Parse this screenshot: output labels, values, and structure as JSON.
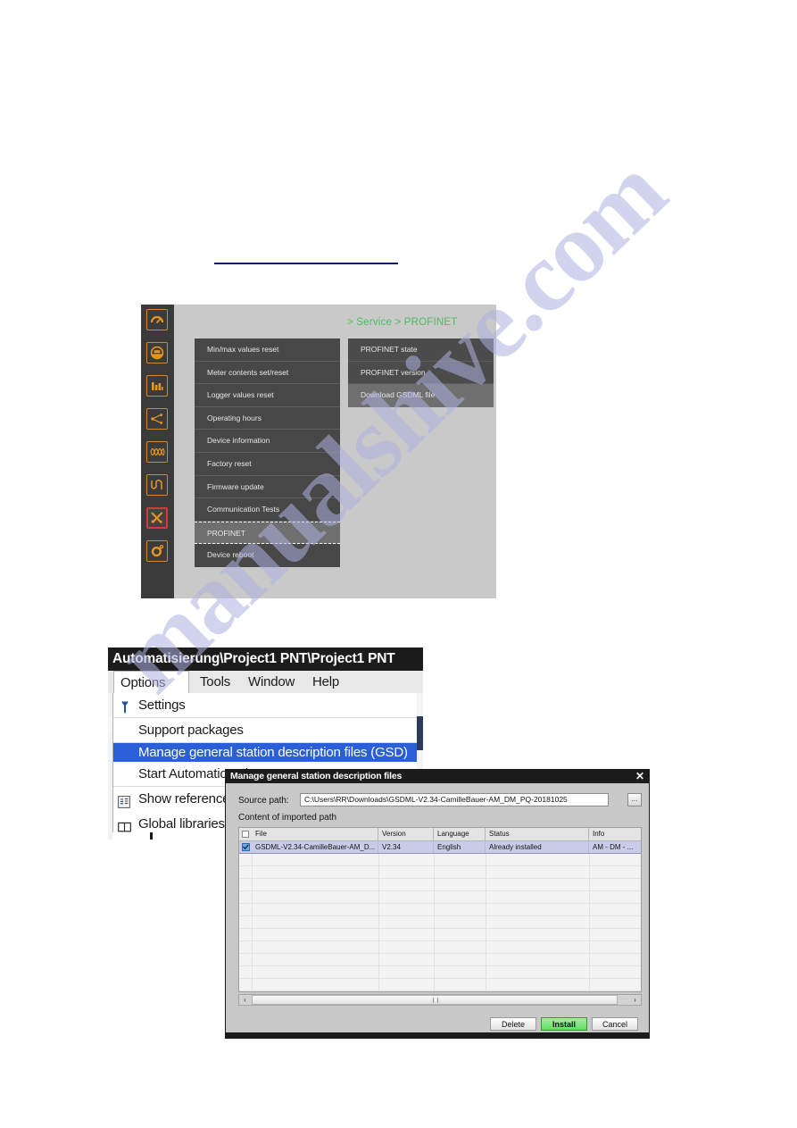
{
  "watermark": {
    "text": "manualshive.com"
  },
  "device_ui": {
    "breadcrumb": "> Service > PROFINET",
    "rail_icons": [
      {
        "name": "gauge-icon"
      },
      {
        "name": "energy-meter-icon"
      },
      {
        "name": "bar-chart-icon"
      },
      {
        "name": "network-topology-icon"
      },
      {
        "name": "harmonics-icon"
      },
      {
        "name": "waveform-icon"
      },
      {
        "name": "service-tools-icon"
      },
      {
        "name": "settings-gear-icon"
      }
    ],
    "menu_left": [
      {
        "label": "Min/max values reset",
        "selected": false
      },
      {
        "label": "Meter contents set/reset",
        "selected": false
      },
      {
        "label": "Logger values reset",
        "selected": false
      },
      {
        "label": "Operating hours",
        "selected": false
      },
      {
        "label": "Device information",
        "selected": false
      },
      {
        "label": "Factory reset",
        "selected": false
      },
      {
        "label": "Firmware update",
        "selected": false
      },
      {
        "label": "Communication Tests",
        "selected": false
      },
      {
        "label": "PROFINET",
        "selected": true
      },
      {
        "label": "Device reboot",
        "selected": false
      }
    ],
    "menu_right": [
      {
        "label": "PROFINET state",
        "selected": false
      },
      {
        "label": "PROFINET version",
        "selected": false
      },
      {
        "label": "Download GSDML file",
        "selected": true
      }
    ]
  },
  "tia": {
    "title": "Automatisierung\\Project1 PNT\\Project1 PNT",
    "menubar": [
      {
        "label": "Options",
        "open": true
      },
      {
        "label": "Tools",
        "open": false
      },
      {
        "label": "Window",
        "open": false
      },
      {
        "label": "Help",
        "open": false
      }
    ],
    "dropdown": [
      {
        "label": "Settings",
        "icon": "wrench-icon",
        "highlighted": false
      },
      {
        "label": "Support packages",
        "icon": "",
        "highlighted": false
      },
      {
        "label": "Manage general station description files (GSD)",
        "icon": "",
        "highlighted": true
      },
      {
        "label": "Start Automation License Manager",
        "icon": "",
        "highlighted": false
      },
      {
        "label": "Show reference text",
        "icon": "reference-text-icon",
        "highlighted": false
      },
      {
        "label": "Global libraries",
        "icon": "book-icon",
        "highlighted": false
      }
    ]
  },
  "gsd_dialog": {
    "title": "Manage general station description files",
    "close_label": "✕",
    "source_path_label": "Source path:",
    "source_path_value": "C:\\Users\\RR\\Downloads\\GSDML-V2.34-CamilleBauer-AM_DM_PQ-20181025",
    "browse_label": "...",
    "content_label": "Content of imported path",
    "columns": [
      "File",
      "Version",
      "Language",
      "Status",
      "Info"
    ],
    "rows": [
      {
        "checked": true,
        "file": "GSDML-V2.34-CamilleBauer-AM_D...",
        "version": "V2.34",
        "language": "English",
        "status": "Already installed",
        "info": "AM - DM - ..."
      }
    ],
    "scroll_left_label": "‹",
    "scroll_right_label": "›",
    "buttons": [
      {
        "label": "Delete",
        "id": "delete"
      },
      {
        "label": "Install",
        "id": "install"
      },
      {
        "label": "Cancel",
        "id": "cancel"
      }
    ]
  }
}
